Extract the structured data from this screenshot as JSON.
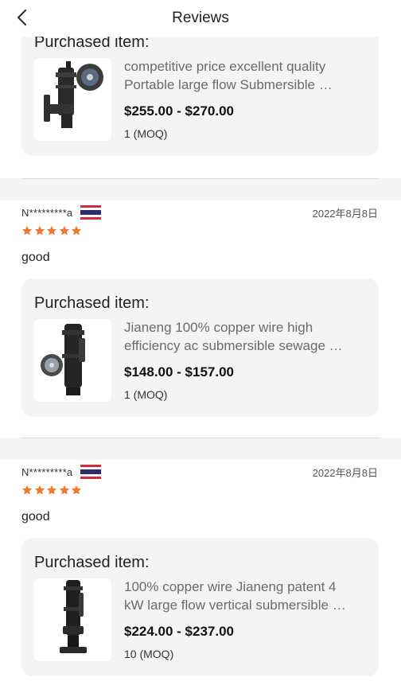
{
  "header": {
    "title": "Reviews",
    "back_icon": "chevron-left-icon"
  },
  "card_heading": "Purchased item:",
  "reviews": [
    {
      "item": {
        "title_line1": "competitive price excellent quality",
        "title_line2": "Portable large flow Submersible …",
        "price": "$255.00 - $270.00",
        "moq": "1 (MOQ)",
        "thumb_icon": "submersible-pump-image"
      }
    },
    {
      "reviewer": "N*********a",
      "flag_icon": "thailand-flag-icon",
      "date": "2022年8月8日",
      "rating": 5,
      "text": "good",
      "item": {
        "title_line1": "Jianeng 100% copper wire high",
        "title_line2": "efficiency ac submersible sewage …",
        "price": "$148.00 - $157.00",
        "moq": "1 (MOQ)",
        "thumb_icon": "sewage-pump-image"
      }
    },
    {
      "reviewer": "N*********a",
      "flag_icon": "thailand-flag-icon",
      "date": "2022年8月8日",
      "rating": 5,
      "text": "good",
      "item": {
        "title_line1": "100% copper wire Jianeng patent 4",
        "title_line2": "kW large flow vertical submersible …",
        "price": "$224.00 - $237.00",
        "moq": "10 (MOQ)",
        "thumb_icon": "vertical-pump-image"
      }
    }
  ],
  "colors": {
    "star": "#ee7a31",
    "background": "#f4f4f4",
    "card": "#f4f4f4",
    "flag_red": "#d52b3c",
    "flag_blue": "#2d2a6d"
  }
}
